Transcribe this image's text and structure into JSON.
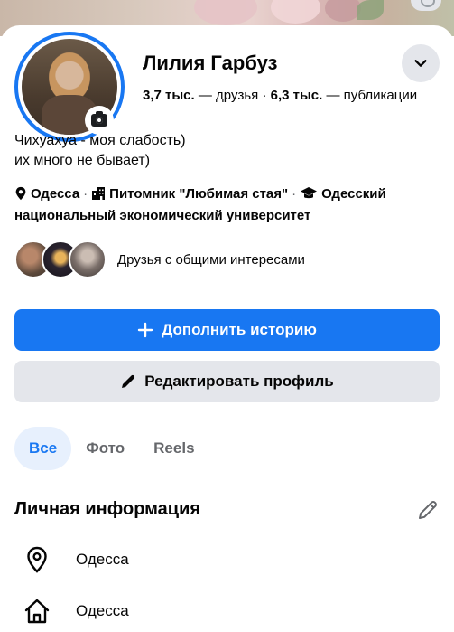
{
  "profile": {
    "name": "Лилия Гарбуз",
    "friends_count": "3,7 тыс.",
    "friends_label": "— друзья",
    "separator": "·",
    "posts_count": "6,3 тыс.",
    "posts_label": "— публикации",
    "bio_line1": "Чихуахуа - моя слабость)",
    "bio_line2": "их много не бывает)",
    "detail_city": "Одесса",
    "detail_work": "Питомник \"Любимая стая\"",
    "detail_edu": "Одесский национальный экономический университет",
    "mutual_text": "Друзья с общими интересами"
  },
  "actions": {
    "primary_label": "Дополнить историю",
    "secondary_label": "Редактировать профиль"
  },
  "tabs": [
    {
      "label": "Все",
      "active": true
    },
    {
      "label": "Фото",
      "active": false
    },
    {
      "label": "Reels",
      "active": false
    }
  ],
  "personal_info": {
    "title": "Личная информация",
    "items": [
      {
        "icon": "location-pin-icon",
        "text": "Одесса"
      },
      {
        "icon": "home-icon",
        "text": "Одесса"
      }
    ]
  },
  "colors": {
    "accent": "#1877f2",
    "secondary_button": "#e4e6eb",
    "active_tab_bg": "#e7f0fd",
    "text": "#050505",
    "muted_text": "#65676b"
  }
}
